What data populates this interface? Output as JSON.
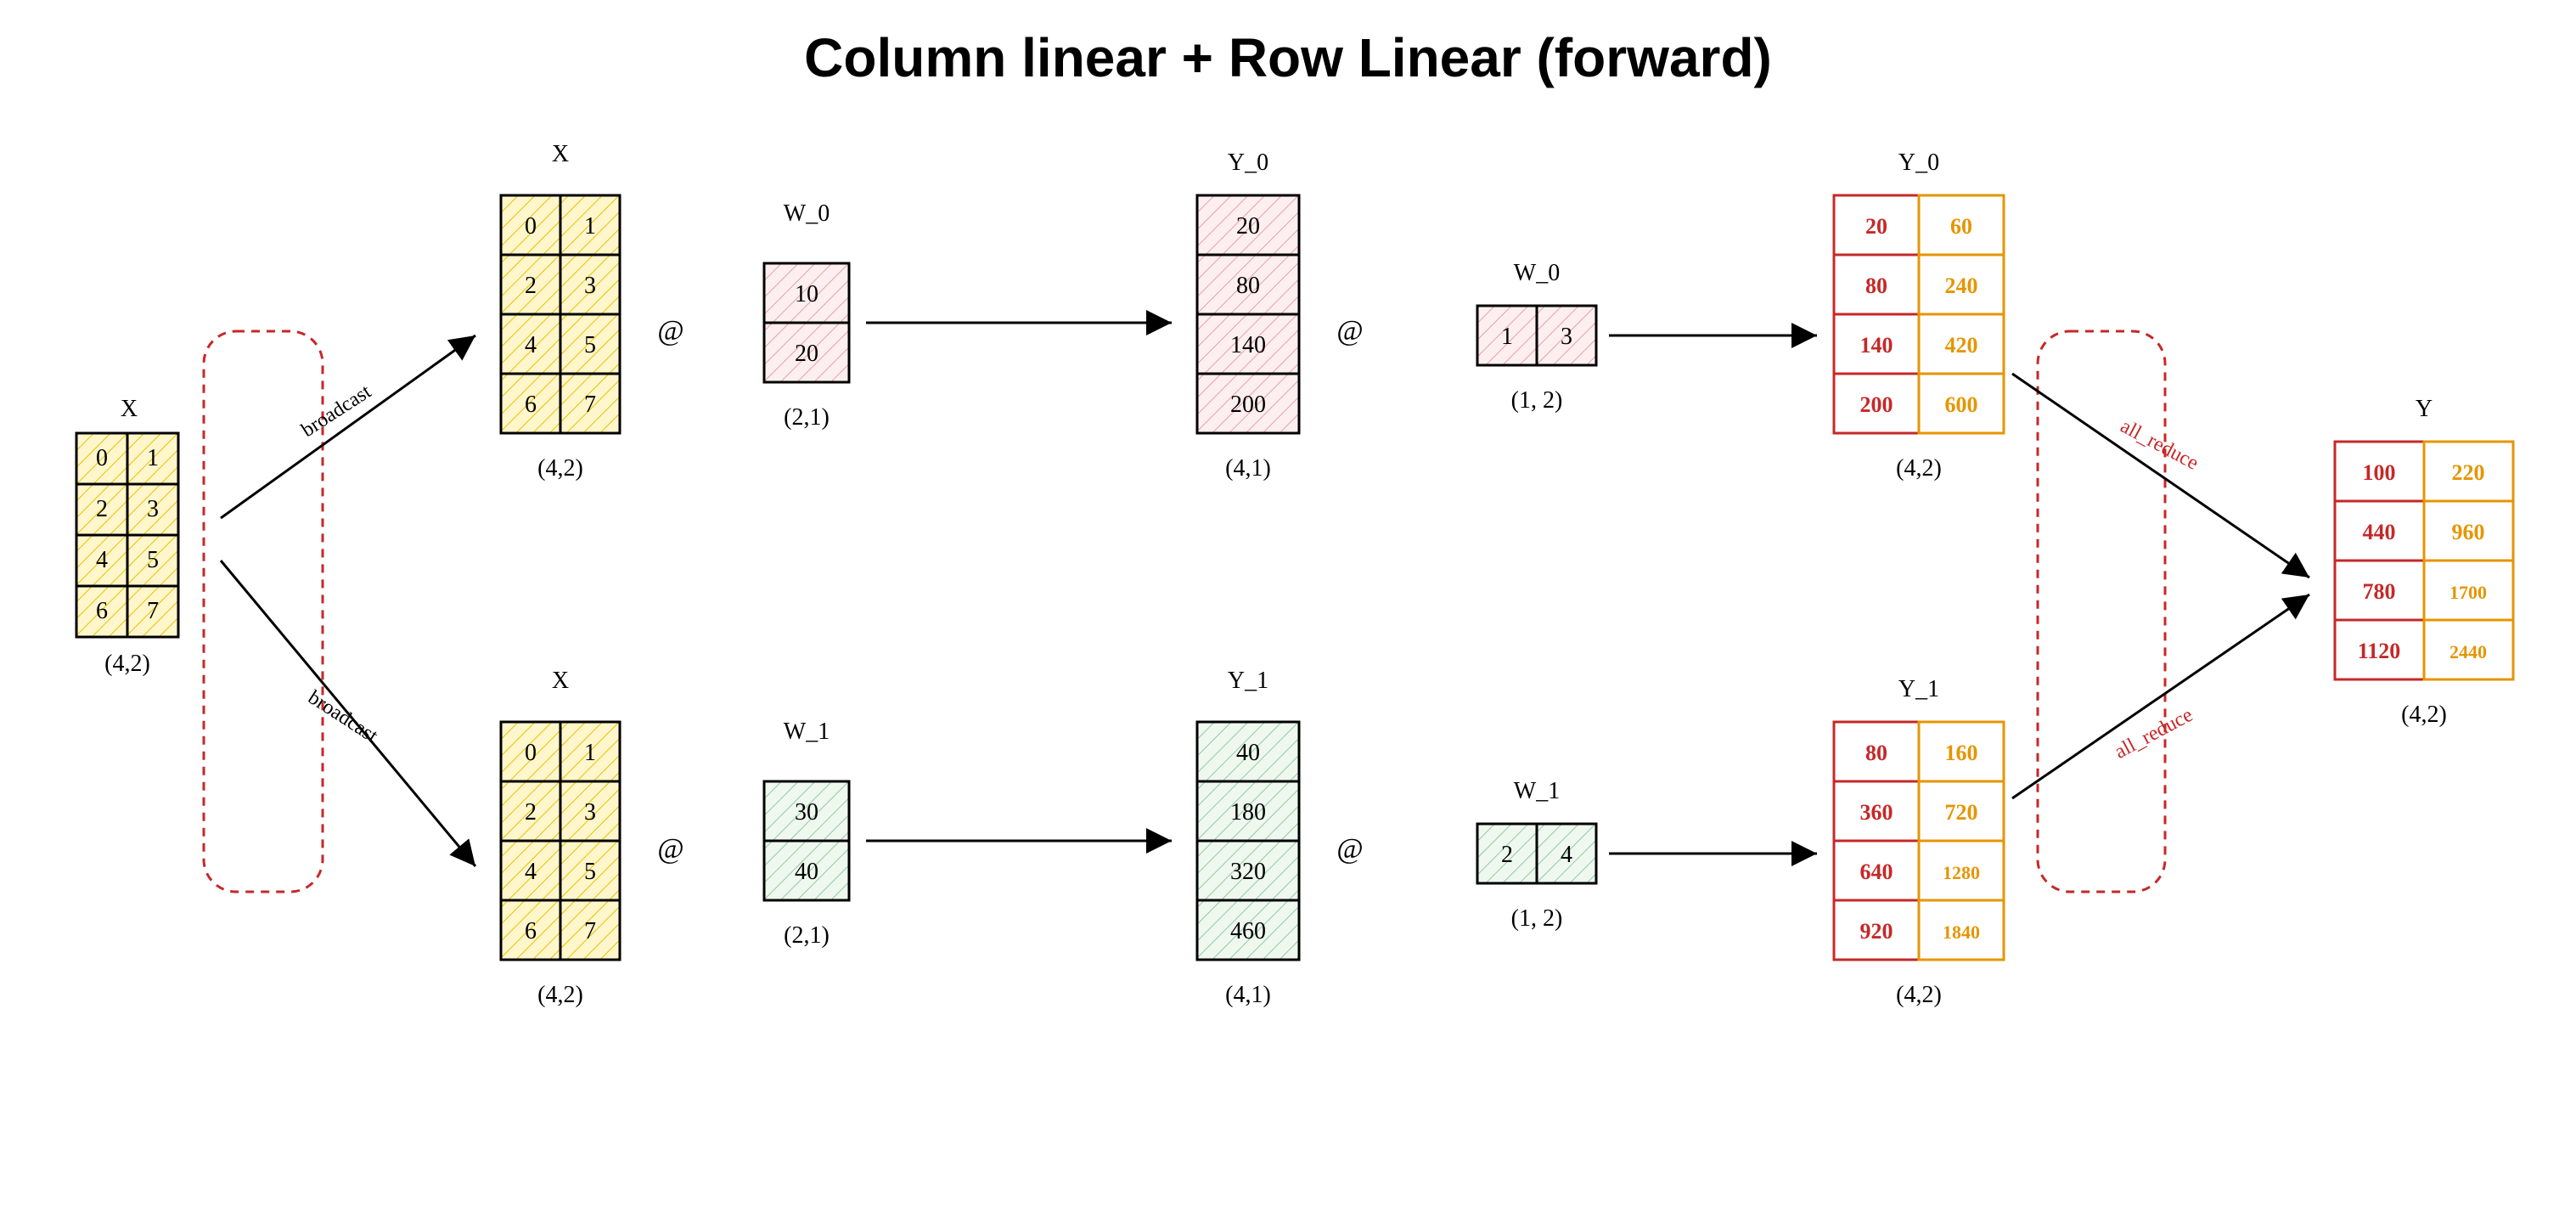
{
  "title": "Column linear + Row Linear (forward)",
  "ops": {
    "matmul": "@"
  },
  "labels": {
    "broadcast": "broadcast",
    "all_reduce": "all_reduce"
  },
  "matrices": {
    "x_in": {
      "name": "X",
      "shape": "(4,2)",
      "rows": [
        [
          "0",
          "1"
        ],
        [
          "2",
          "3"
        ],
        [
          "4",
          "5"
        ],
        [
          "6",
          "7"
        ]
      ]
    },
    "x_top": {
      "name": "X",
      "shape": "(4,2)",
      "rows": [
        [
          "0",
          "1"
        ],
        [
          "2",
          "3"
        ],
        [
          "4",
          "5"
        ],
        [
          "6",
          "7"
        ]
      ]
    },
    "x_bot": {
      "name": "X",
      "shape": "(4,2)",
      "rows": [
        [
          "0",
          "1"
        ],
        [
          "2",
          "3"
        ],
        [
          "4",
          "5"
        ],
        [
          "6",
          "7"
        ]
      ]
    },
    "w0_col": {
      "name": "W_0",
      "shape": "(2,1)",
      "rows": [
        [
          "10"
        ],
        [
          "20"
        ]
      ]
    },
    "w1_col": {
      "name": "W_1",
      "shape": "(2,1)",
      "rows": [
        [
          "30"
        ],
        [
          "40"
        ]
      ]
    },
    "y0_col": {
      "name": "Y_0",
      "shape": "(4,1)",
      "rows": [
        [
          "20"
        ],
        [
          "80"
        ],
        [
          "140"
        ],
        [
          "200"
        ]
      ]
    },
    "y1_col": {
      "name": "Y_1",
      "shape": "(4,1)",
      "rows": [
        [
          "40"
        ],
        [
          "180"
        ],
        [
          "320"
        ],
        [
          "460"
        ]
      ]
    },
    "w0_row": {
      "name": "W_0",
      "shape": "(1, 2)",
      "rows": [
        [
          "1",
          "3"
        ]
      ]
    },
    "w1_row": {
      "name": "W_1",
      "shape": "(1, 2)",
      "rows": [
        [
          "2",
          "4"
        ]
      ]
    },
    "y0_part": {
      "name": "Y_0",
      "shape": "(4,2)",
      "rows": [
        [
          "20",
          "60"
        ],
        [
          "80",
          "240"
        ],
        [
          "140",
          "420"
        ],
        [
          "200",
          "600"
        ]
      ]
    },
    "y1_part": {
      "name": "Y_1",
      "shape": "(4,2)",
      "rows": [
        [
          "80",
          "160"
        ],
        [
          "360",
          "720"
        ],
        [
          "640",
          "1280"
        ],
        [
          "920",
          "1840"
        ]
      ]
    },
    "y_out": {
      "name": "Y",
      "shape": "(4,2)",
      "rows": [
        [
          "100",
          "220"
        ],
        [
          "440",
          "960"
        ],
        [
          "780",
          "1700"
        ],
        [
          "1120",
          "2440"
        ]
      ]
    }
  }
}
